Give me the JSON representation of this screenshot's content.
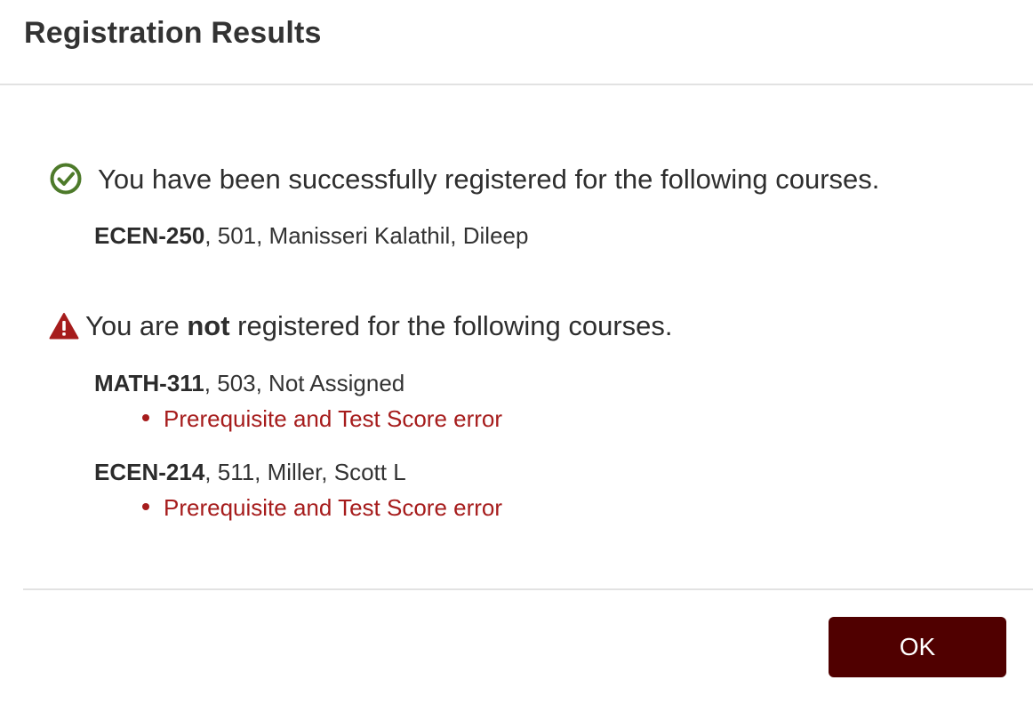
{
  "dialog": {
    "title": "Registration Results"
  },
  "success": {
    "icon": "check-circle-icon",
    "icon_color": "#4d7a2a",
    "message": "You have been successfully registered for the following courses.",
    "courses": [
      {
        "code": "ECEN-250",
        "details": ", 501, Manisseri Kalathil, Dileep"
      }
    ]
  },
  "failure": {
    "icon": "warning-triangle-icon",
    "icon_color": "#a61c1c",
    "message_prefix": "You are ",
    "message_emphasis": "not",
    "message_suffix": " registered for the following courses.",
    "courses": [
      {
        "code": "MATH-311",
        "details": ", 503, Not Assigned",
        "errors": [
          "Prerequisite and Test Score error"
        ]
      },
      {
        "code": "ECEN-214",
        "details": ", 511, Miller, Scott L",
        "errors": [
          "Prerequisite and Test Score error"
        ]
      }
    ]
  },
  "footer": {
    "ok_label": "OK",
    "button_color": "#500000"
  }
}
